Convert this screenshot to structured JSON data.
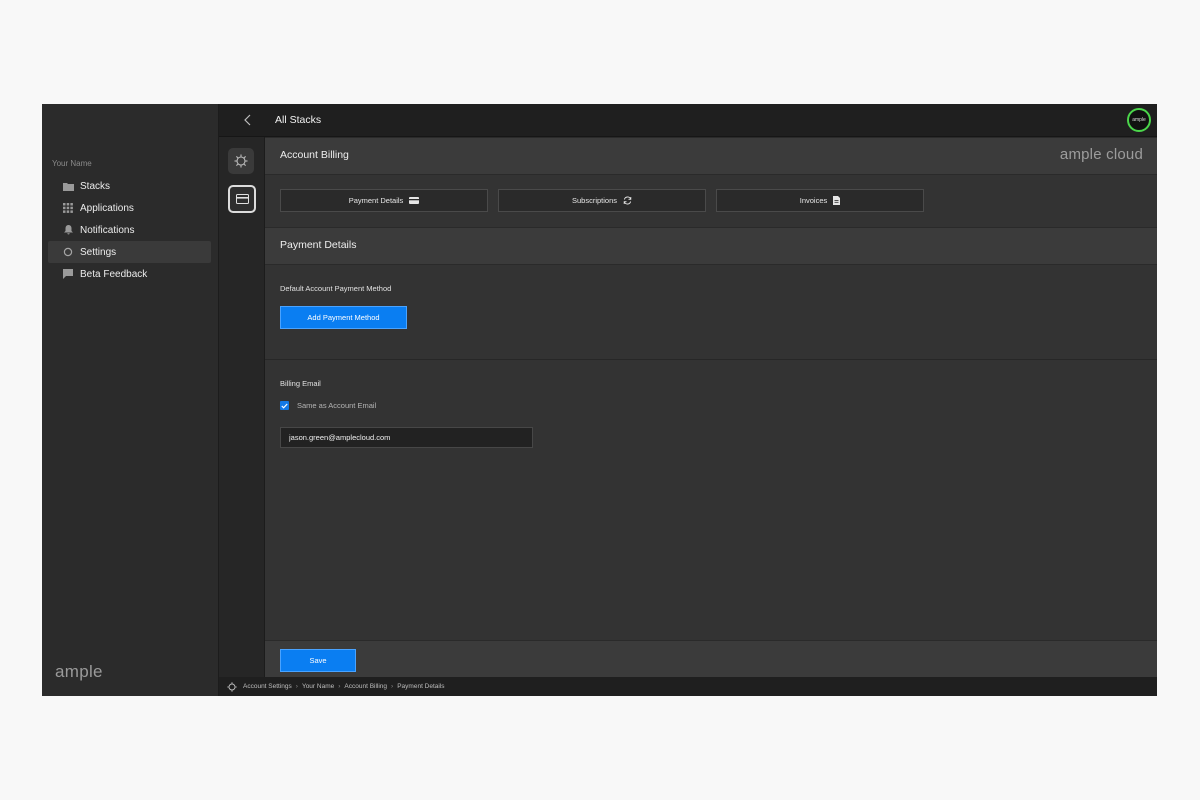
{
  "sidebar": {
    "user_name": "Your Name",
    "items": [
      {
        "label": "Stacks",
        "icon": "folder-icon"
      },
      {
        "label": "Applications",
        "icon": "grid-icon"
      },
      {
        "label": "Notifications",
        "icon": "bell-icon"
      },
      {
        "label": "Settings",
        "icon": "gear-icon",
        "active": true
      },
      {
        "label": "Beta Feedback",
        "icon": "chat-icon"
      }
    ],
    "brand": "ample"
  },
  "topbar": {
    "title": "All Stacks",
    "avatar_text": "ample"
  },
  "header": {
    "title": "Account Billing",
    "logo": "ample cloud"
  },
  "tabs": [
    {
      "label": "Payment Details",
      "icon": "card-icon"
    },
    {
      "label": "Subscriptions",
      "icon": "refresh-icon"
    },
    {
      "label": "Invoices",
      "icon": "document-icon"
    }
  ],
  "payment_details": {
    "title": "Payment Details",
    "default_method_label": "Default Account Payment Method",
    "add_button": "Add Payment Method"
  },
  "billing_email": {
    "label": "Billing Email",
    "same_as_label": "Same as Account Email",
    "checked": true,
    "email_value": "jason.green@amplecloud.com"
  },
  "footer": {
    "save_label": "Save"
  },
  "breadcrumb": [
    "Account Settings",
    "Your Name",
    "Account Billing",
    "Payment Details"
  ],
  "colors": {
    "accent": "#0a7ef2",
    "avatar_ring": "#4bd64b"
  }
}
